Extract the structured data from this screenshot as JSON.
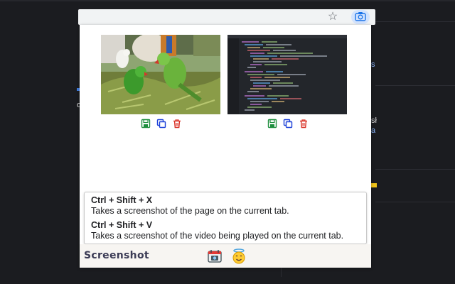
{
  "toolbar": {
    "icons": [
      "star-icon",
      "camera-icon"
    ]
  },
  "background_fragments": [
    "s",
    "o",
    "sł",
    "a"
  ],
  "screenshots": [
    {
      "kind": "photo",
      "subject": "parrots",
      "actions": [
        "save-icon",
        "copy-icon",
        "delete-icon"
      ]
    },
    {
      "kind": "photo",
      "subject": "code-editor",
      "actions": [
        "save-icon",
        "copy-icon",
        "delete-icon"
      ]
    }
  ],
  "shortcuts": [
    {
      "keys": "Ctrl + Shift + X",
      "description": "Takes a screenshot of the page on the current tab."
    },
    {
      "keys": "Ctrl + Shift + V",
      "description": "Takes a screenshot of the video being played on the current tab."
    }
  ],
  "footer": {
    "brand": "Screenshot",
    "icons": [
      "calendar-camera-icon",
      "smiley-halo-icon"
    ]
  },
  "colors": {
    "save": "#1e8e3e",
    "copy": "#1a3fd8",
    "delete": "#d93025",
    "background": "#1b1c20"
  }
}
